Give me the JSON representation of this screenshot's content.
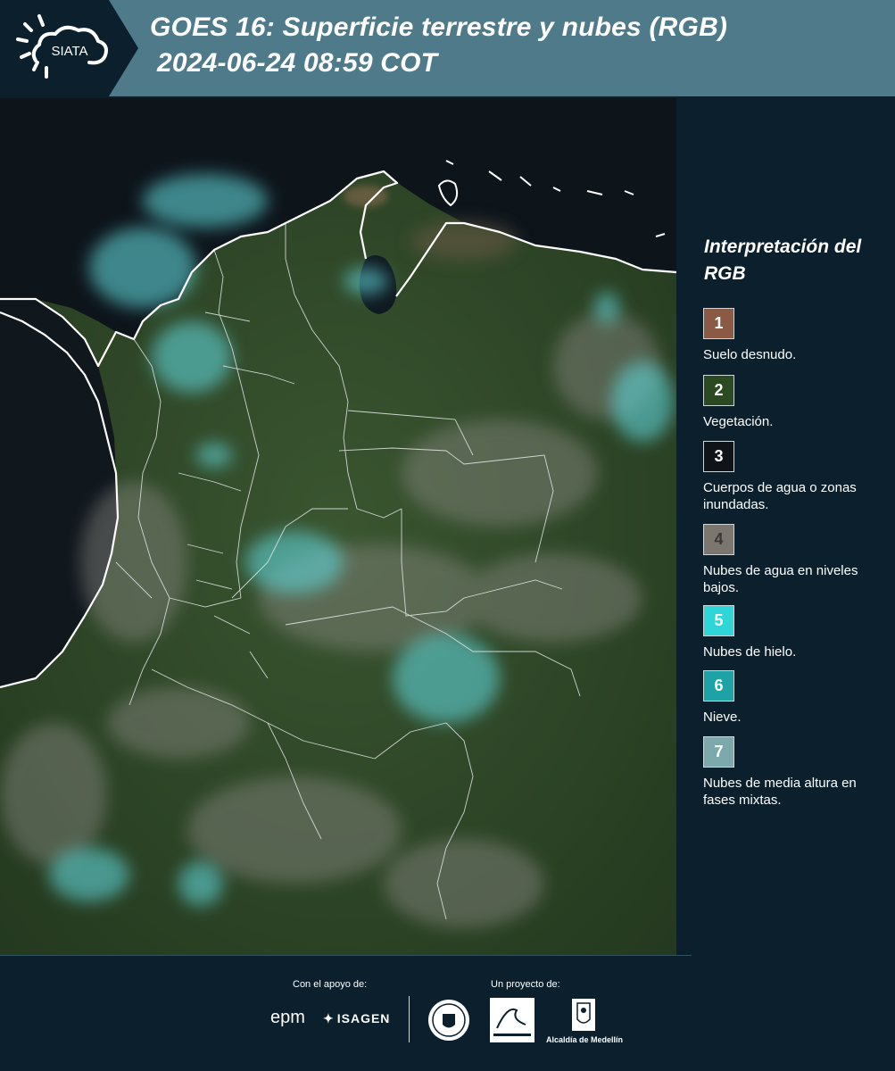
{
  "header": {
    "logo_text": "SIATA",
    "title_line1": "GOES 16: Superficie terrestre y nubes (RGB)",
    "title_line2": "2024-06-24 08:59 COT",
    "colors": {
      "bar": "#4e7a8a",
      "logo_bg": "#0b1f2c"
    }
  },
  "map": {
    "description_icon": "satellite-rgb-composite-image"
  },
  "legend": {
    "title": "Interpretación del RGB",
    "items": [
      {
        "number": "1",
        "label": "Suelo desnudo.",
        "color": "#8a5a44"
      },
      {
        "number": "2",
        "label": "Vegetación.",
        "color": "#2b4a22"
      },
      {
        "number": "3",
        "label": "Cuerpos de agua o zonas inundadas.",
        "color": "#0e1418"
      },
      {
        "number": "4",
        "label": "Nubes de agua en niveles bajos.",
        "color": "#7c7670"
      },
      {
        "number": "5",
        "label": "Nubes de hielo.",
        "color": "#2fd6d8"
      },
      {
        "number": "6",
        "label": "Nieve.",
        "color": "#1da3a6"
      },
      {
        "number": "7",
        "label": "Nubes de media altura en fases mixtas.",
        "color": "#7ea9ac"
      }
    ]
  },
  "footer": {
    "support_label": "Con el apoyo de:",
    "project_label": "Un proyecto de:",
    "epm": "epm",
    "isagen": "ISAGEN",
    "alcaldia": "Alcaldía de Medellín"
  }
}
